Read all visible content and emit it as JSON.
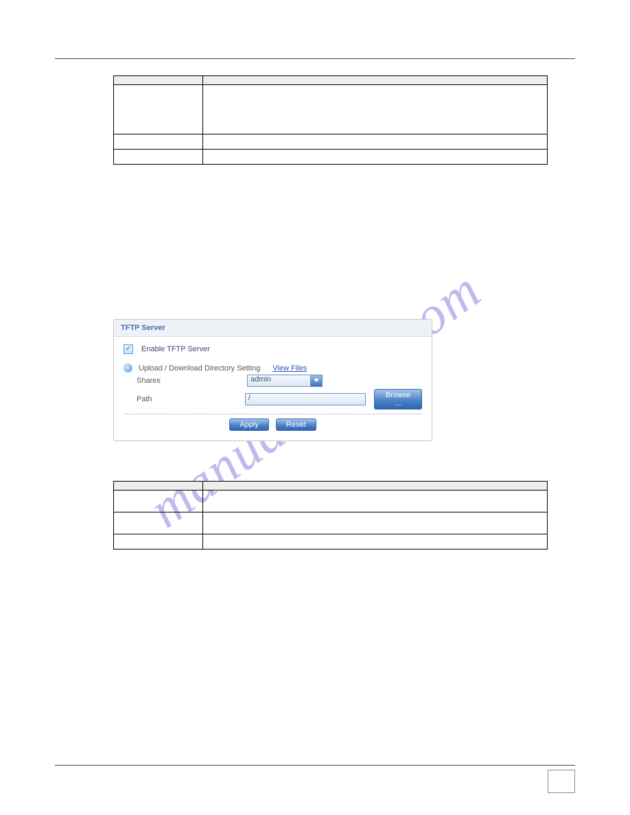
{
  "watermark": "manualshive.com",
  "table1": {
    "header_label": "",
    "header_desc": "",
    "rows": [
      {
        "label": "",
        "desc": ""
      },
      {
        "label": "",
        "desc": ""
      },
      {
        "label": "",
        "desc": ""
      }
    ]
  },
  "tftp_panel": {
    "title": "TFTP Server",
    "enable_label": "Enable TFTP Server",
    "enable_checked": true,
    "section_label": "Upload / Download Directory Setting",
    "view_files": "View Files",
    "shares_label": "Shares",
    "shares_value": "admin",
    "path_label": "Path",
    "path_value": "/",
    "browse_label": "Browse ...",
    "apply_label": "Apply",
    "reset_label": "Reset"
  },
  "table2": {
    "header_label": "",
    "header_desc": "",
    "rows": [
      {
        "label": "",
        "desc": ""
      },
      {
        "label": "",
        "desc": ""
      },
      {
        "label": "",
        "desc": ""
      }
    ]
  }
}
